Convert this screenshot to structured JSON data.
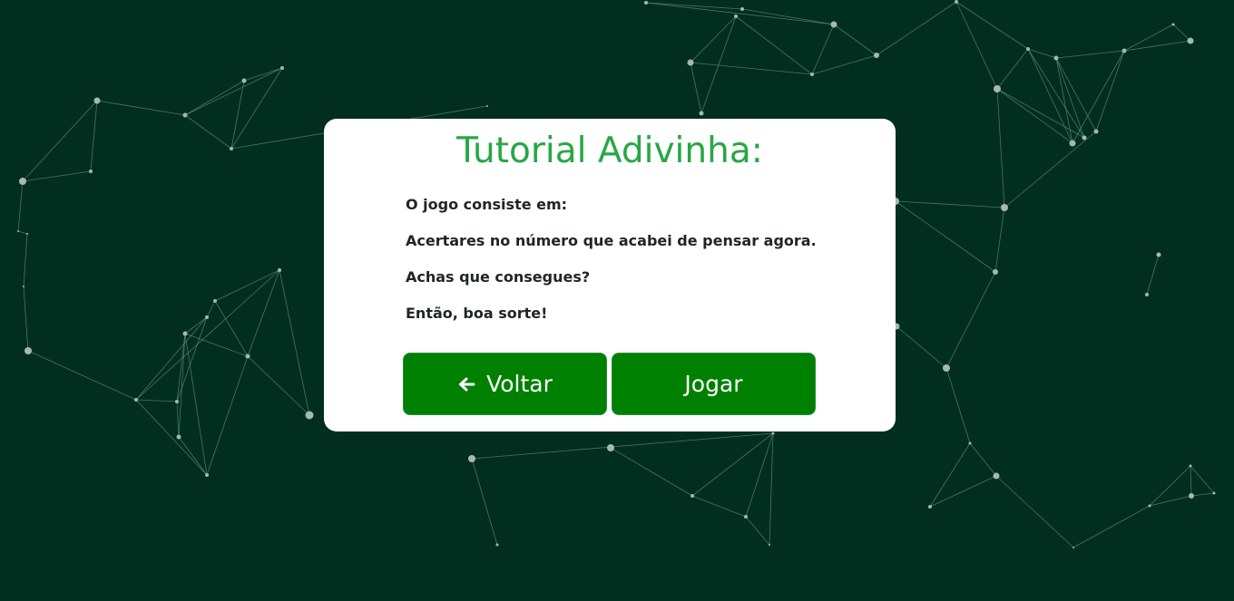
{
  "colors": {
    "background": "#022e1f",
    "title": "#28a745",
    "button": "#008000",
    "network_line": "#5f8f7a",
    "network_node": "#a7b8ae"
  },
  "tutorial": {
    "title": "Tutorial Adivinha:",
    "lines": [
      "O jogo consiste em:",
      "Acertares no número que acabei de pensar agora.",
      "Achas que consegues?",
      "Então, boa sorte!"
    ],
    "back_label": "Voltar",
    "back_icon": "arrow-left-icon",
    "play_label": "Jogar"
  }
}
